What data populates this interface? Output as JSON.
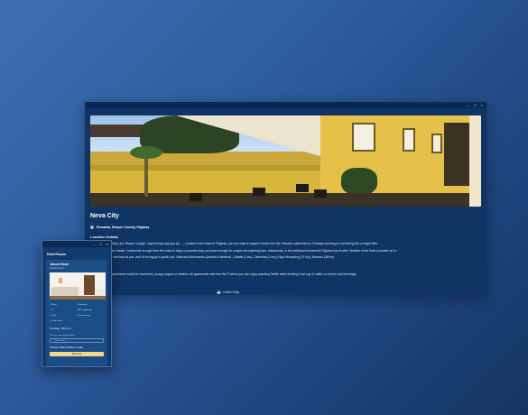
{
  "main_window": {
    "listing": {
      "title": "Neva City",
      "location": "Romania, Brașov County, Făgăraș",
      "location_details_heading": "Location Details",
      "location_details_line1": "... Str. ... 10, Făgăraș, jud. Brașov Google : https://maps.app.goo.gl/... — located in the heart of Făgăraș, you can walk to organic charts from the Orthodox cathedral on a Sunday morning or rest feeling like a knight after",
      "location_details_line2": "... ugh the majestic citadel. Located far enough from the noise to enjoy a peaceful stay, yet close enough for a night out exploring bars, restaurants, or the historical monuments Făgăraș has to offer. Breathe in the fresh mountain air or",
      "location_details_line3": "... gifted peaks a ride back at you, and I'd be happy to guide you. Historical Monuments (closest to farthest) - Citadel (1 km), Cathedral (1 km), Kupa Monastery (12 km), Museum (48 km)",
      "hotel_heading": "Hotel",
      "hotel_text": "... ern spacious apartments suited for bachelors, young couples or families. All apartments offer free Wi-Fi where you can enjoy watching Netflix while drinking a hot cup of coffee or a fresh cold beverage.",
      "amenities_heading": "Amenities",
      "amenity_label": "Coffee Shop"
    }
  },
  "overlay_window": {
    "heading": "Hotel Rooms",
    "room": {
      "name": "Jacuzzi Room",
      "type": "Double Room",
      "features": [
        "1 Bed",
        "Bathroom",
        "TV",
        "Air conditioning",
        "Wi-Fi",
        "Free parking",
        "Coffee Shop",
        "Bar"
      ],
      "price_label": "Price/Day: 280.0 Lei",
      "discount_label": "Discount code applied above",
      "promo_placeholder": "Promo code",
      "total_label": "Total Price 280.0 Lei/Room 1 night",
      "book_button": "Book now"
    }
  },
  "colors": {
    "desktop_gradient": "#2f5ea0",
    "window_bg": "#0f3566",
    "card_bg": "#1a4c86",
    "button_bg": "#f1d98a"
  },
  "icons": {
    "location": "location-pin-icon",
    "coffee": "coffee-icon",
    "window_controls": [
      "minimize-icon",
      "maximize-icon",
      "close-icon"
    ]
  }
}
